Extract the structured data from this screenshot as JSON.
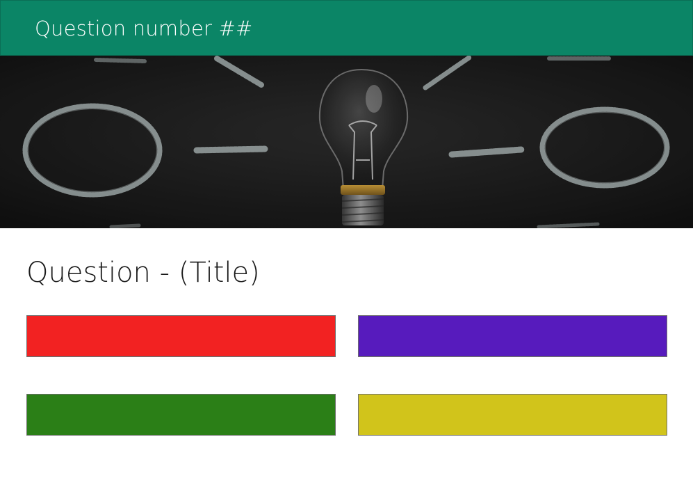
{
  "header": {
    "title": "Question number ##",
    "color": "#0b8566"
  },
  "banner": {
    "subject": "light bulb on chalkboard"
  },
  "question": {
    "title": "Question - (Title)"
  },
  "answers": [
    {
      "label": "",
      "color": "#f22222"
    },
    {
      "label": "",
      "color": "#571bbd"
    },
    {
      "label": "",
      "color": "#2b7f17"
    },
    {
      "label": "",
      "color": "#d1c41b"
    }
  ]
}
